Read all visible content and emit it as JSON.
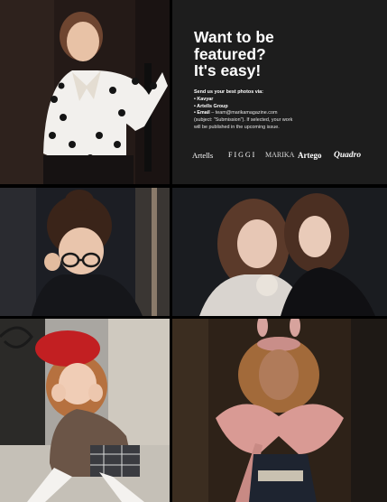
{
  "feature": {
    "headline": [
      "Want to be",
      "featured?",
      "It's easy!"
    ],
    "intro": "Send us your best photos via:",
    "bullets": [
      "• Kavyar",
      "• Artells Group"
    ],
    "email_prefix": "• Email",
    "email_text": " – team@marikamagazine.com",
    "email_subject": "(subject: \"Submission\"). If selected, your work",
    "closing": "will be published in the upcoming issue.",
    "logos": [
      "Artells",
      "FIGGI",
      "MARIKA",
      "Artego",
      "Quadro"
    ]
  },
  "photos": [
    {
      "subject": "girl in polka-dot blouse seated on chair",
      "bg": "#2a1e1a"
    },
    {
      "subject": "girl with glasses in dark outfit",
      "bg": "#1b1d22"
    },
    {
      "subject": "two girls with curly hair",
      "bg": "#1a1a1e"
    },
    {
      "subject": "girl in red beret sitting on step",
      "bg": "#a8a6a2"
    },
    {
      "subject": "girl with pink bow and bunny headpiece",
      "bg": "#3a2a1c"
    }
  ]
}
